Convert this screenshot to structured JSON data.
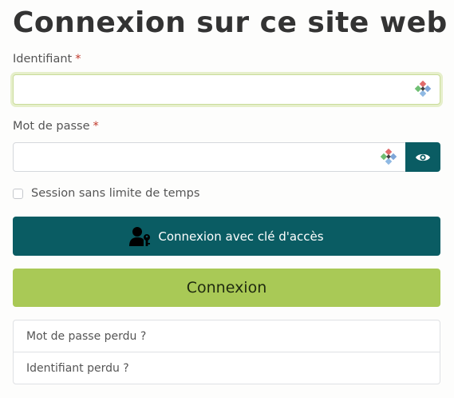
{
  "page": {
    "title": "Connexion sur ce site web"
  },
  "username": {
    "label": "Identifiant",
    "required_mark": "*",
    "value": "",
    "placeholder": "",
    "password_manager_icon": "password-manager-icon"
  },
  "password": {
    "label": "Mot de passe",
    "required_mark": "*",
    "value": "",
    "placeholder": "",
    "password_manager_icon": "password-manager-icon",
    "reveal_icon": "eye-icon"
  },
  "remember": {
    "label": "Session sans limite de temps",
    "checked": false
  },
  "passkey_button": {
    "label": "Connexion avec clé d'accès",
    "icon": "user-key-icon"
  },
  "login_button": {
    "label": "Connexion"
  },
  "help_links": [
    {
      "label": "Mot de passe perdu ?"
    },
    {
      "label": "Identifiant perdu ?"
    }
  ],
  "colors": {
    "primary": "#0a5c63",
    "accent": "#a9c956",
    "required": "#c0392b"
  }
}
